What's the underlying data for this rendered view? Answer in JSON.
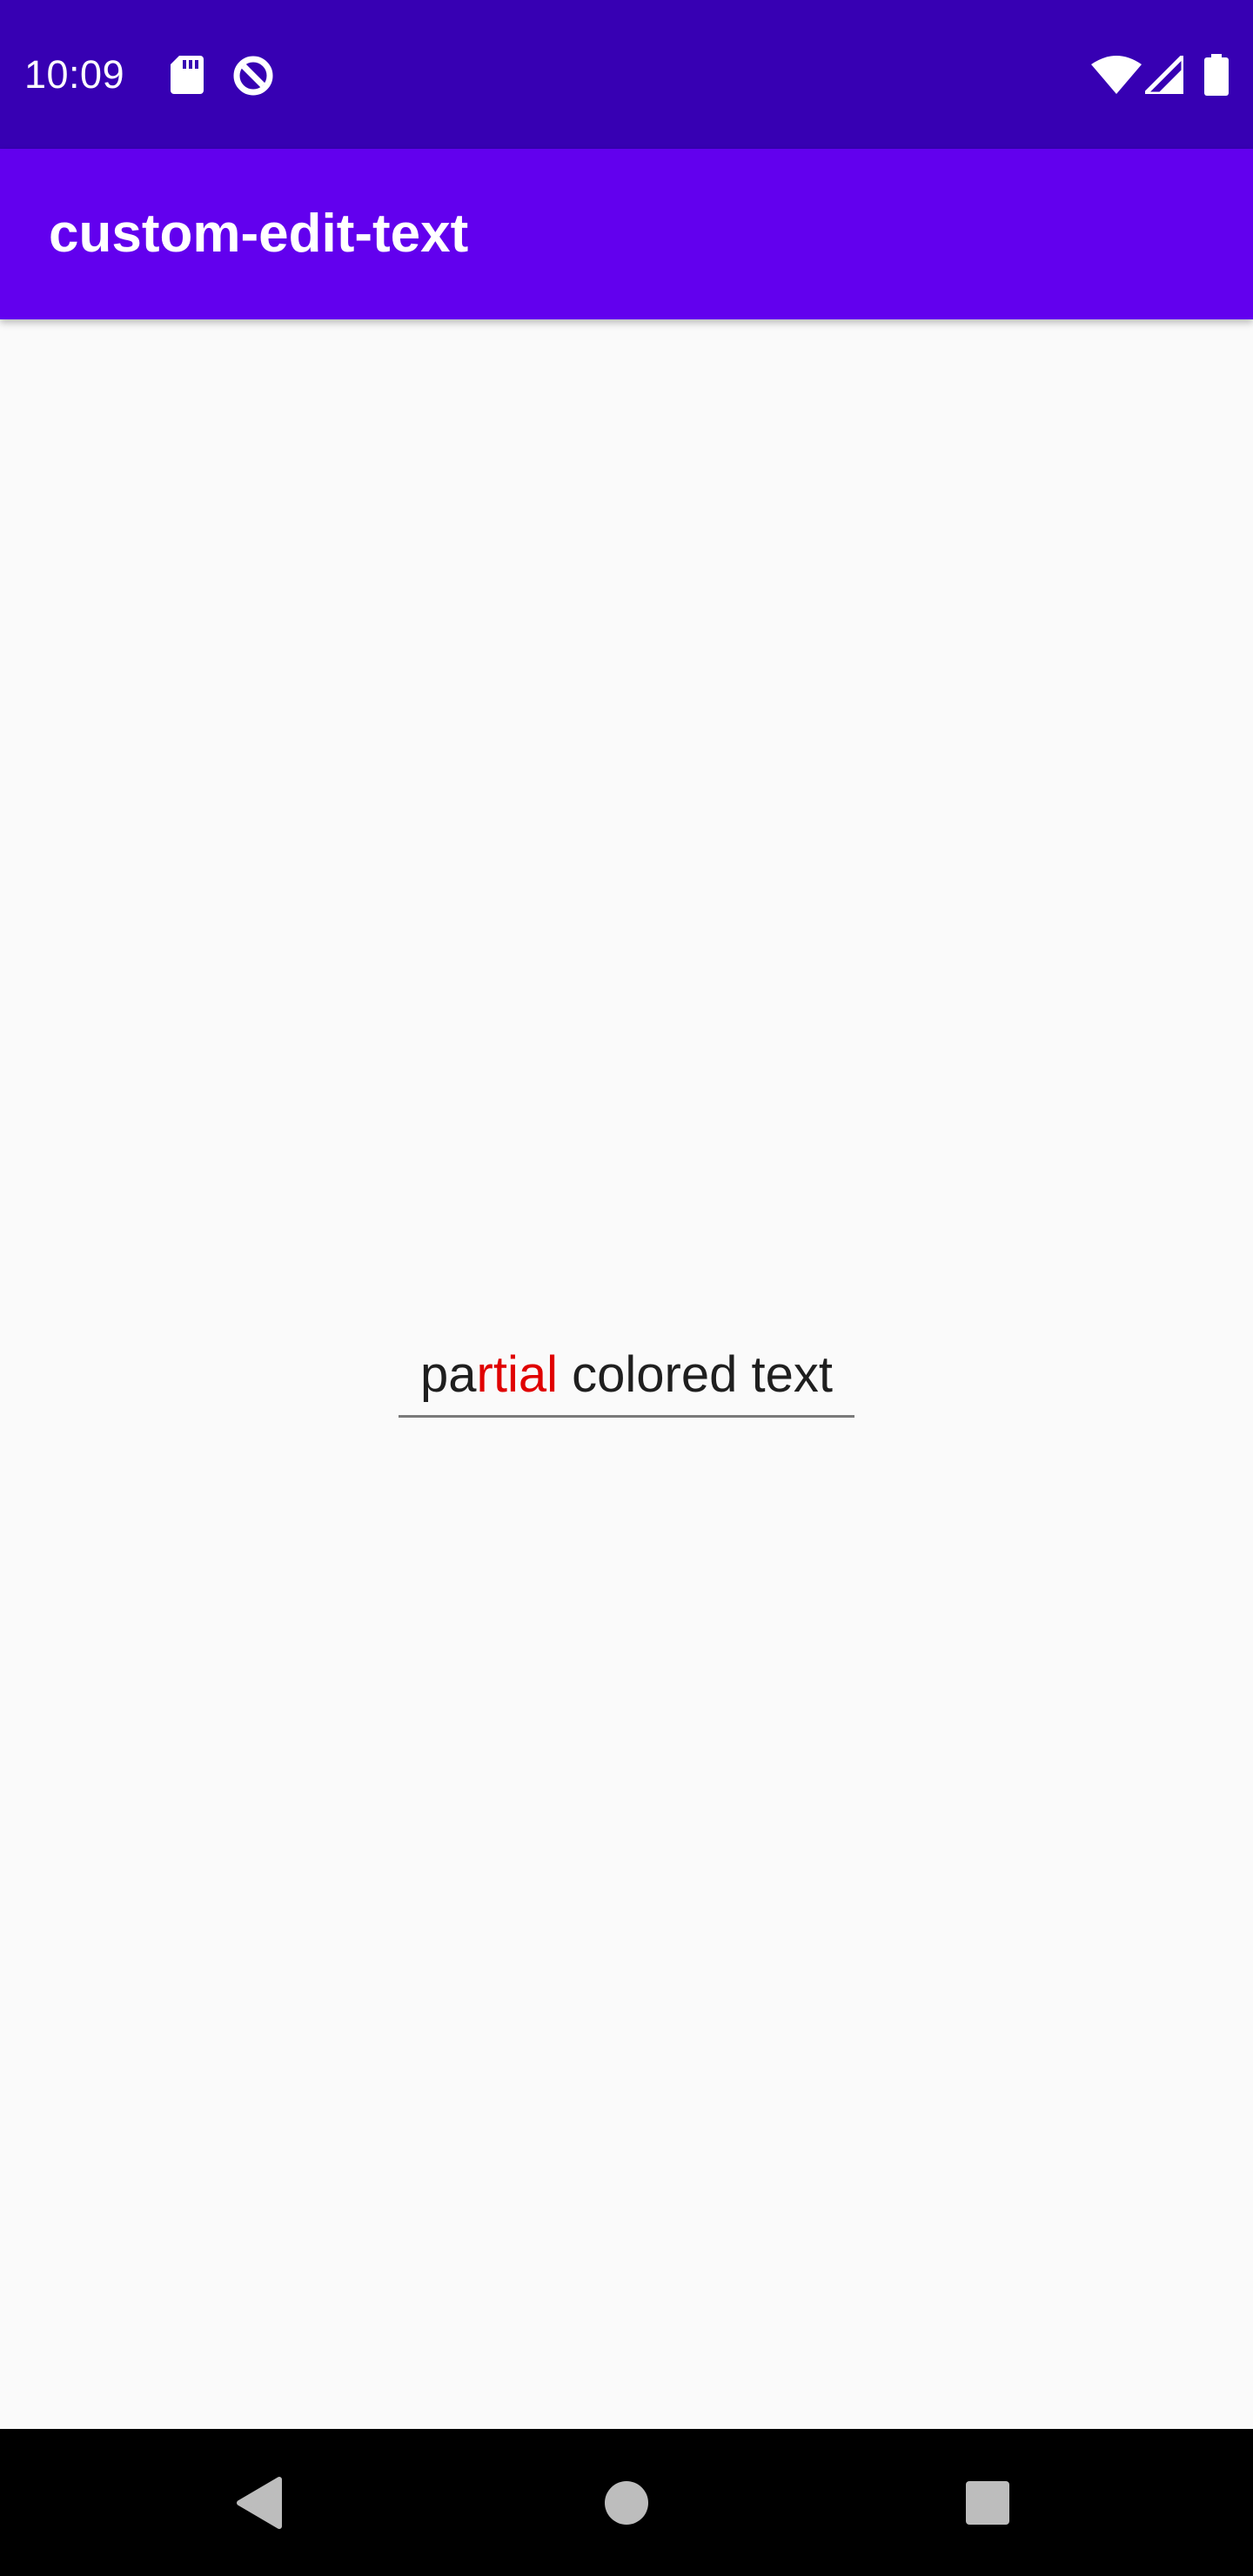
{
  "status_bar": {
    "time": "10:09",
    "background_color": "#3700b3",
    "icons": [
      "sd-card-icon",
      "data-saver-icon",
      "wifi-icon",
      "cell-signal-icon",
      "battery-icon"
    ]
  },
  "app_bar": {
    "title": "custom-edit-text",
    "background_color": "#6200ee"
  },
  "edit_text": {
    "segments": [
      {
        "text": "pa",
        "color": "#1f1f1f"
      },
      {
        "text": "rtial",
        "color": "#e00000"
      },
      {
        "text": " colored text",
        "color": "#1f1f1f"
      }
    ]
  },
  "nav_bar": {
    "buttons": [
      "back-icon",
      "home-icon",
      "recents-icon"
    ]
  }
}
